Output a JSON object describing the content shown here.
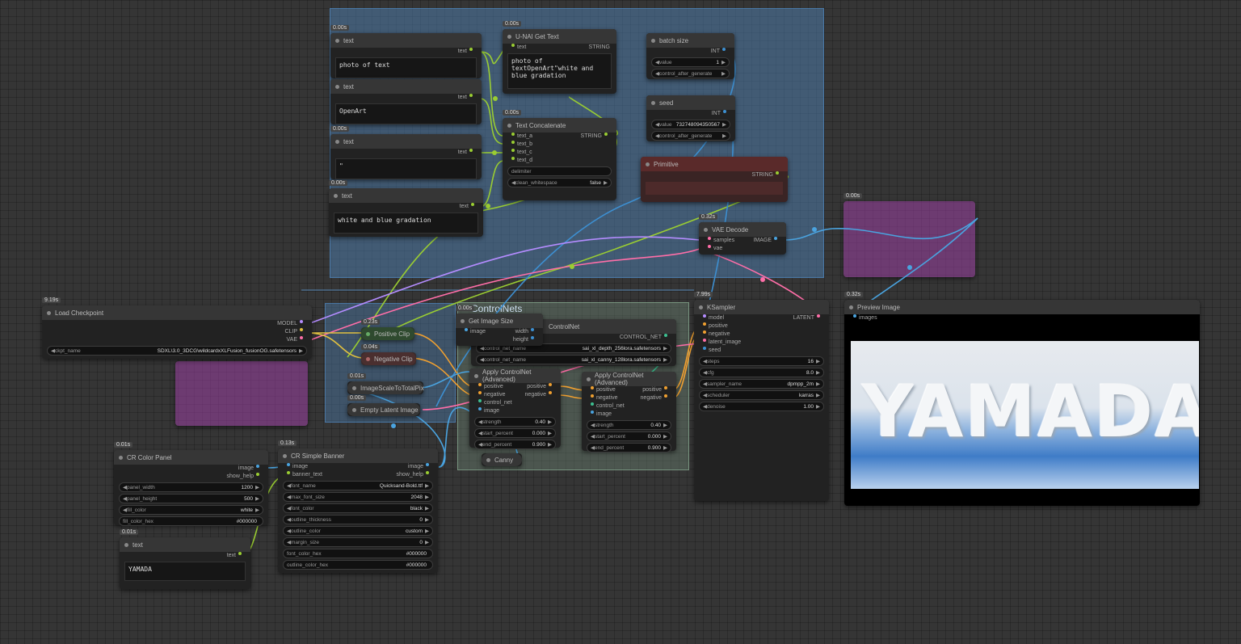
{
  "groups": {
    "controlnets": "ControlNets"
  },
  "nodes": {
    "text1": {
      "timing": "0.00s",
      "title": "text",
      "out": "text",
      "value": "photo of text"
    },
    "text2": {
      "title": "text",
      "out": "text",
      "value": "OpenArt"
    },
    "text3": {
      "timing": "0.00s",
      "title": "text",
      "out": "text",
      "value": "\""
    },
    "text4": {
      "timing": "0.00s",
      "title": "text",
      "out": "text",
      "value": "white and blue gradation"
    },
    "getText": {
      "timing": "0.00s",
      "title": "U-NAI Get Text",
      "in": "text",
      "out": "STRING",
      "value": "photo of textOpenArt\"white and blue gradation"
    },
    "concat": {
      "timing": "0.00s",
      "title": "Text Concatenate",
      "out": "STRING",
      "inputs": [
        "text_a",
        "text_b",
        "text_c",
        "text_d"
      ],
      "w1": "delimiter",
      "w2_label": "clean_whitespace",
      "w2_val": "false"
    },
    "batch": {
      "title": "batch size",
      "out": "INT",
      "w1_label": "value",
      "w1_val": "1",
      "w2_label": "control_after_generate"
    },
    "seed": {
      "title": "seed",
      "out": "INT",
      "w1_label": "value",
      "w1_val": "732748094350567",
      "w2_label": "control_after_generate"
    },
    "primitive": {
      "title": "Primitive",
      "out": "STRING"
    },
    "vae": {
      "timing": "0.32s",
      "title": "VAE Decode",
      "in1": "samples",
      "in2": "vae",
      "out": "IMAGE"
    },
    "load": {
      "timing": "9.19s",
      "title": "Load Checkpoint",
      "outs": [
        "MODEL",
        "CLIP",
        "VAE"
      ],
      "w_label": "ckpt_name",
      "w_val": "SDXL\\3.0_3DCG\\wildcardxXLFusion_fusionOG.safetensors"
    },
    "posclip": {
      "timing": "0.23s",
      "title": "Positive Clip"
    },
    "negclip": {
      "timing": "0.04s",
      "title": "Negative Clip"
    },
    "scale": {
      "timing": "0.01s",
      "title": "ImageScaleToTotalPix"
    },
    "latent": {
      "timing": "0.00s",
      "title": "Empty Latent Image"
    },
    "getsize": {
      "timing": "0.00s",
      "title": "Get Image Size",
      "in": "image",
      "outs": [
        "width",
        "height"
      ]
    },
    "cnloader": {
      "title": "ControlNet",
      "out": "CONTROL_NET",
      "w1_label": "control_net_name",
      "w1_val": "sai_xl_depth_256lora.safetensors",
      "w2_label": "control_net_name",
      "w2_val": "sai_xl_canny_128lora.safetensors"
    },
    "apply1": {
      "title": "Apply ControlNet (Advanced)",
      "ins": [
        "positive",
        "negative",
        "control_net",
        "image"
      ],
      "outs": [
        "positive",
        "negative"
      ],
      "w": [
        [
          "strength",
          "0.40"
        ],
        [
          "start_percent",
          "0.000"
        ],
        [
          "end_percent",
          "0.900"
        ]
      ]
    },
    "apply2": {
      "title": "Apply ControlNet (Advanced)",
      "ins": [
        "positive",
        "negative",
        "control_net",
        "image"
      ],
      "outs": [
        "positive",
        "negative"
      ],
      "w": [
        [
          "strength",
          "0.40"
        ],
        [
          "start_percent",
          "0.000"
        ],
        [
          "end_percent",
          "0.900"
        ]
      ]
    },
    "canny": {
      "title": "Canny"
    },
    "ksampler": {
      "timing": "7.99s",
      "title": "KSampler",
      "ins": [
        "model",
        "positive",
        "negative",
        "latent_image",
        "seed"
      ],
      "out": "LATENT",
      "w": [
        [
          "steps",
          "16"
        ],
        [
          "cfg",
          "8.0"
        ],
        [
          "sampler_name",
          "dpmpp_2m"
        ],
        [
          "scheduler",
          "karras"
        ],
        [
          "denoise",
          "1.00"
        ]
      ]
    },
    "preview": {
      "timing": "0.32s",
      "title": "Preview Image",
      "in": "images",
      "image_text": "YAMADA"
    },
    "colorpanel": {
      "timing": "0.01s",
      "title": "CR Color Panel",
      "outs": [
        "image",
        "show_help"
      ],
      "w": [
        [
          "panel_width",
          "1200"
        ],
        [
          "panel_height",
          "500"
        ],
        [
          "fill_color",
          "white"
        ],
        [
          "fill_color_hex",
          "#000000"
        ]
      ]
    },
    "text5": {
      "timing": "0.01s",
      "title": "text",
      "out": "text",
      "value": "YAMADA"
    },
    "banner": {
      "timing": "0.13s",
      "title": "CR Simple Banner",
      "ins": [
        "image",
        "banner_text"
      ],
      "outs": [
        "image",
        "show_help"
      ],
      "w": [
        [
          "font_name",
          "Quicksand-Bold.ttf"
        ],
        [
          "max_font_size",
          "2048"
        ],
        [
          "font_color",
          "black"
        ],
        [
          "outline_thickness",
          "0"
        ],
        [
          "outline_color",
          "custom"
        ],
        [
          "margin_size",
          "0"
        ],
        [
          "font_color_hex",
          "#000000"
        ],
        [
          "outline_color_hex",
          "#000000"
        ]
      ]
    },
    "faded1": {
      "timing": "0.00s"
    }
  },
  "colors": {
    "group_blue": "#4a7aa8",
    "faded_pink": "#9b3fa3",
    "primitive_red": "#5a2a2a"
  }
}
